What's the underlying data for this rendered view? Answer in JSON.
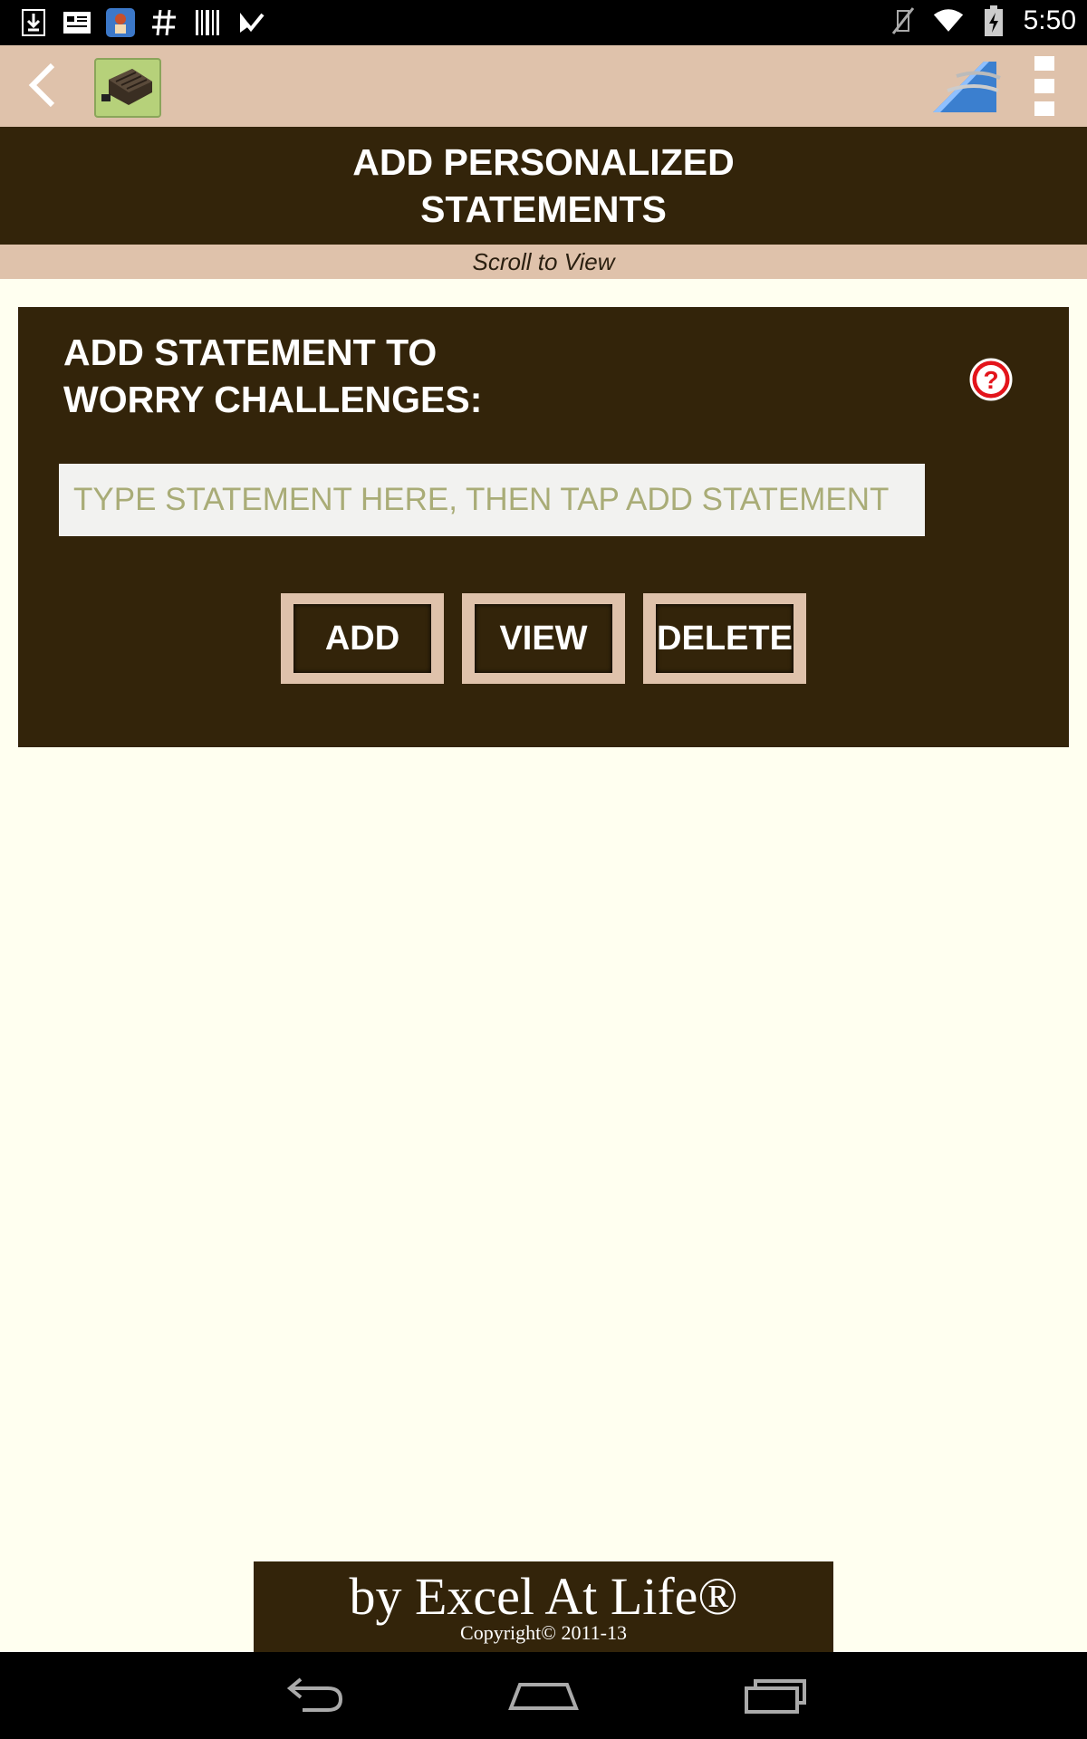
{
  "status_bar": {
    "time": "5:50",
    "left_icons": [
      "download-icon",
      "news-icon",
      "app-notification-icon",
      "hashtag-icon",
      "barcode-icon",
      "checkmark-icon"
    ],
    "right_icons": [
      "vibrate-mute-icon",
      "wifi-icon",
      "battery-icon"
    ]
  },
  "action_bar": {
    "back_icon": "chevron-left-icon",
    "app_icon": "app-logo-icon",
    "share_icon": "share-icon",
    "menu_icon": "overflow-menu-icon"
  },
  "title": "ADD PERSONALIZED STATEMENTS",
  "scroll_hint": "Scroll to View",
  "panel": {
    "heading": "ADD STATEMENT TO WORRY CHALLENGES:",
    "help_icon": "help-icon",
    "input_placeholder": "TYPE STATEMENT HERE, THEN TAP ADD STATEMENT",
    "input_value": "",
    "buttons": {
      "add": "ADD",
      "view": "VIEW",
      "delete": "DELETE"
    }
  },
  "branding": {
    "main": "by Excel At Life®",
    "copyright": "Copyright© 2011-13"
  },
  "nav_bar": {
    "back": "back-icon",
    "home": "home-icon",
    "recents": "recents-icon"
  },
  "colors": {
    "dark_brown": "#33240a",
    "tan": "#dfc2ab",
    "background": "#fffff0",
    "placeholder": "#a9ac77",
    "help_red": "#e3141b"
  }
}
